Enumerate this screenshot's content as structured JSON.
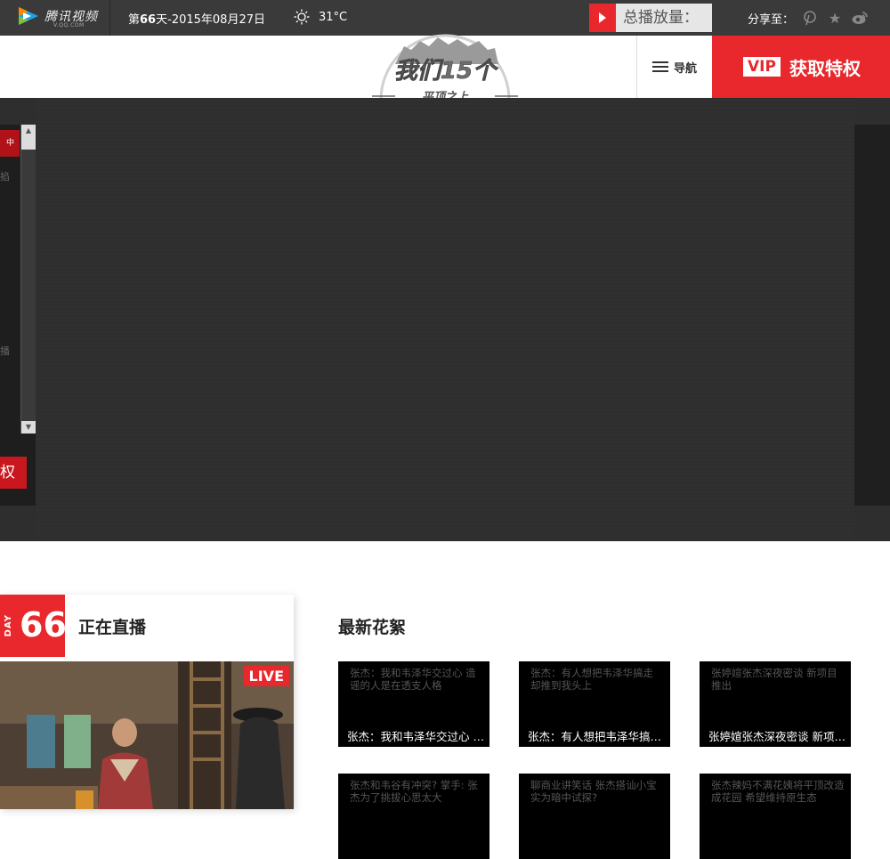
{
  "topbar": {
    "brand_name": "腾讯视频",
    "brand_domain": "V.QQ.COM",
    "day_prefix": "第",
    "day_number": "66",
    "day_suffix": "天",
    "date": "-2015年08月27日",
    "temperature": "31°C",
    "plays_label": "总播放量：",
    "share_label": "分享至："
  },
  "header": {
    "show_logo_main": "我们15个",
    "show_logo_sub": "平顶之上",
    "nav_label": "导航",
    "vip_tag": "VIP",
    "vip_text": "获取特权"
  },
  "player": {
    "left_red_label": "中",
    "left_text_1": "掐",
    "left_text_2": "播",
    "left_button": "权"
  },
  "live": {
    "day_label": "DAY",
    "day_number": "66",
    "title": "正在直播",
    "live_tag": "LIVE"
  },
  "clips": {
    "title": "最新花絮",
    "items": [
      {
        "desc": "张杰：我和韦泽华交过心 造谣的人是在透支人格",
        "caption": "张杰：我和韦泽华交过心 造谣的人是在透支人格"
      },
      {
        "desc": "张杰：有人想把韦泽华搞走 却推到我头上",
        "caption": "张杰：有人想把韦泽华搞走 却推到我头上"
      },
      {
        "desc": "张婷媗张杰深夜密谈 新项目推出",
        "caption": "张婷媗张杰深夜密谈 新项目推出"
      },
      {
        "desc": "张杰和韦谷有冲突? 掌手: 张杰为了挑拔心思太大",
        "caption": ""
      },
      {
        "desc": "聊商业讲笑话 张杰搭讪小宝实为暗中试探?",
        "caption": ""
      },
      {
        "desc": "张杰辣妈不满花姨将平顶改造成花园 希望维持原生态",
        "caption": ""
      }
    ]
  },
  "colors": {
    "accent_red": "#e8282d",
    "topbar_bg": "#3a3a3a",
    "player_bg": "#2e2e2e"
  },
  "icons": [
    "play-logo-icon",
    "sun-icon",
    "play-arrow-icon",
    "pinterest-icon",
    "star-icon",
    "weibo-icon",
    "hamburger-icon"
  ]
}
